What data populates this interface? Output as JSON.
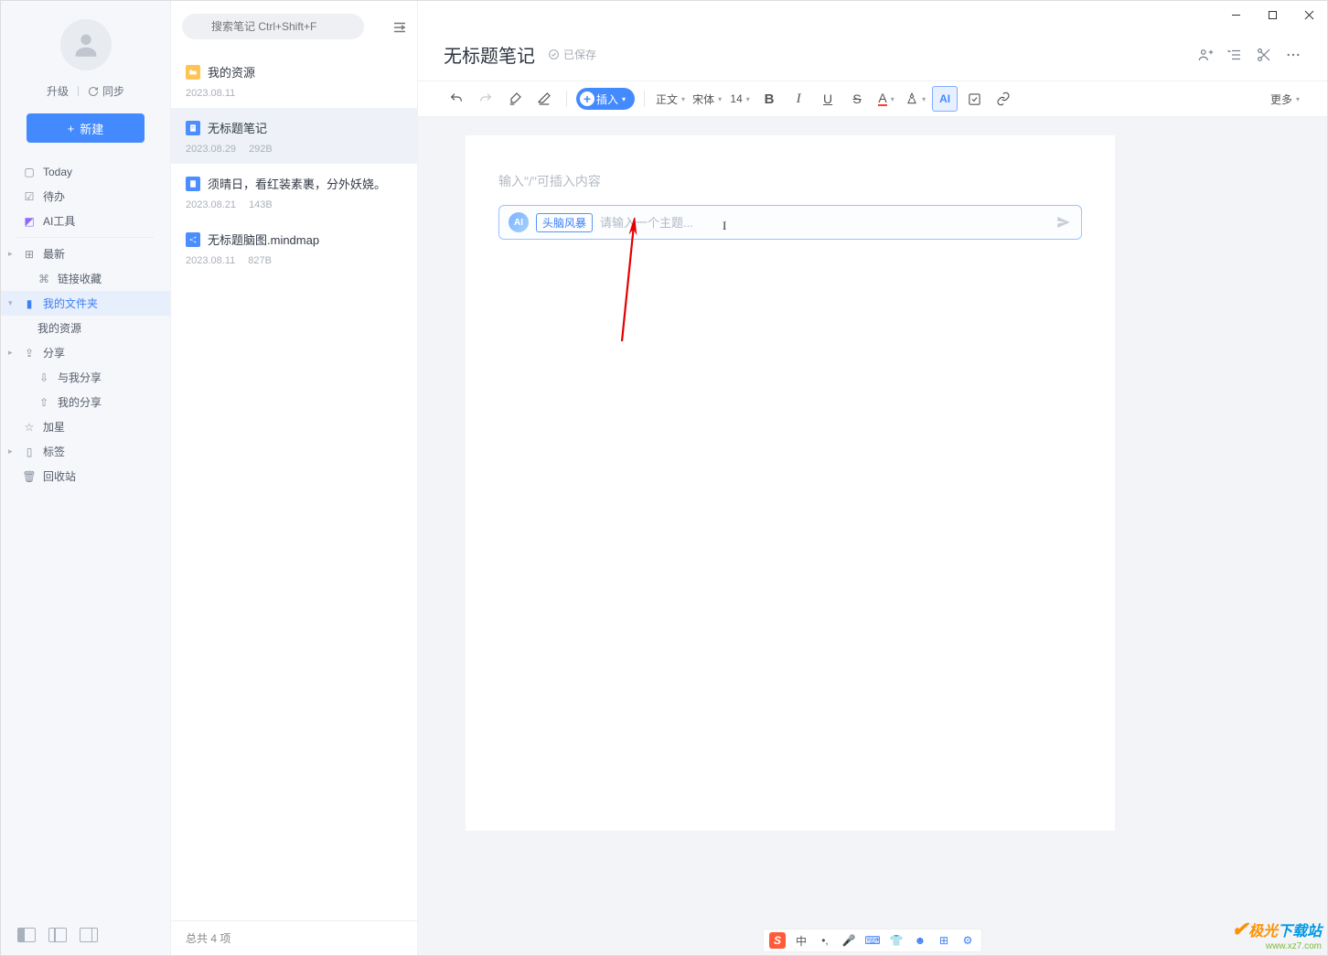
{
  "window": {
    "title": "无标题笔记"
  },
  "profile": {
    "upgrade": "升级",
    "sync": "同步"
  },
  "new_button": "新建",
  "nav": {
    "today": "Today",
    "todo": "待办",
    "ai_tools": "AI工具",
    "recent": "最新",
    "link_fav": "链接收藏",
    "my_folder": "我的文件夹",
    "my_resource": "我的资源",
    "share": "分享",
    "shared_with_me": "与我分享",
    "my_share": "我的分享",
    "starred": "加星",
    "tags": "标签",
    "trash": "回收站"
  },
  "search": {
    "placeholder": "搜索笔记 Ctrl+Shift+F"
  },
  "notes": [
    {
      "title": "我的资源",
      "date": "2023.08.11",
      "size": "",
      "type": "folder"
    },
    {
      "title": "无标题笔记",
      "date": "2023.08.29",
      "size": "292B",
      "type": "doc"
    },
    {
      "title": "须晴日，看红装素裹，分外妖娆。",
      "date": "2023.08.21",
      "size": "143B",
      "type": "doc"
    },
    {
      "title": "无标题脑图.mindmap",
      "date": "2023.08.11",
      "size": "827B",
      "type": "mind"
    }
  ],
  "list_footer": "总共 4 项",
  "doc": {
    "title": "无标题笔记",
    "save_status": "已保存"
  },
  "toolbar": {
    "insert": "插入",
    "paragraph": "正文",
    "font": "宋体",
    "size": "14",
    "more": "更多"
  },
  "editor": {
    "placeholder": "输入\"/\"可插入内容",
    "ai_tag": "头脑风暴",
    "ai_placeholder": "请输入一个主题..."
  },
  "ime": {
    "lang": "中"
  },
  "watermark": {
    "brand_pre": "极光",
    "brand_post": "下载站",
    "url": "www.xz7.com"
  }
}
